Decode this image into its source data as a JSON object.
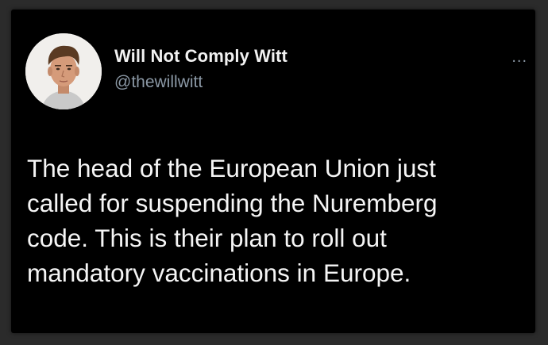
{
  "user": {
    "display_name": "Will Not Comply Witt",
    "handle": "@thewillwitt",
    "avatar_icon": "profile-photo"
  },
  "menu": {
    "more_label": "..."
  },
  "tweet": {
    "lines": [
      "The head of the European Union just",
      "called for suspending the Nuremberg",
      "code. This is their plan to roll out",
      "mandatory vaccinations in Europe."
    ]
  },
  "colors": {
    "background": "#000000",
    "name": "#f2f2f2",
    "handle": "#8b98a5",
    "text": "#f5f5f5"
  }
}
